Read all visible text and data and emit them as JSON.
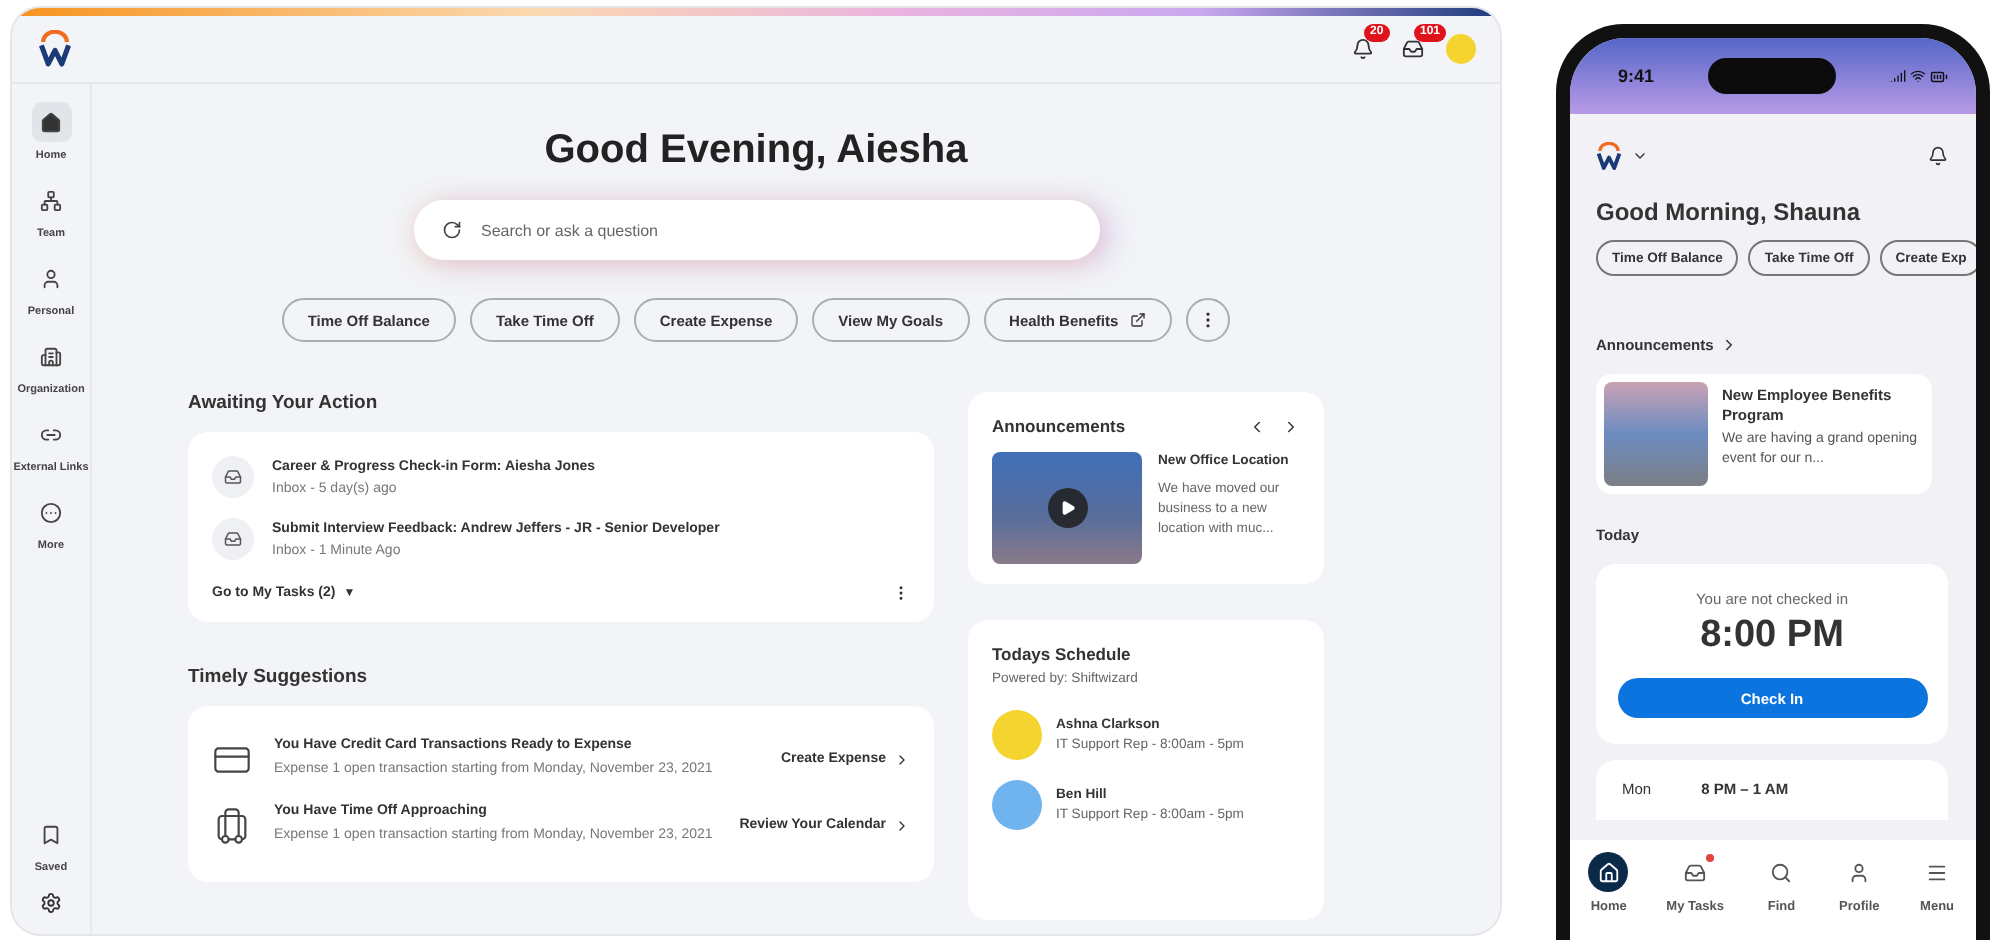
{
  "desktop": {
    "notifications": [
      {
        "kind": "bell",
        "count": "20"
      },
      {
        "kind": "inbox",
        "count": "101"
      }
    ],
    "sidebar": {
      "items": [
        {
          "label": "Home",
          "selected": true
        },
        {
          "label": "Team",
          "selected": false
        },
        {
          "label": "Personal",
          "selected": false
        },
        {
          "label": "Organization",
          "selected": false
        },
        {
          "label": "External Links",
          "selected": false
        },
        {
          "label": "More",
          "selected": false
        }
      ],
      "bottom_items": [
        {
          "label": "Saved",
          "selected": false
        }
      ]
    },
    "greeting": "Good Evening, Aiesha",
    "search": {
      "placeholder": "Search or ask a question"
    },
    "quick_actions": [
      {
        "label": "Time Off Balance",
        "external": false
      },
      {
        "label": "Take Time Off",
        "external": false
      },
      {
        "label": "Create Expense",
        "external": false
      },
      {
        "label": "View My Goals",
        "external": false
      },
      {
        "label": "Health Benefits",
        "external": true
      }
    ],
    "awaiting": {
      "title": "Awaiting Your Action",
      "tasks": [
        {
          "title": "Career & Progress Check-in Form: Aiesha Jones",
          "meta": "Inbox - 5 day(s) ago"
        },
        {
          "title": "Submit Interview Feedback: Andrew Jeffers - JR - Senior Developer",
          "meta": "Inbox - 1 Minute Ago"
        }
      ],
      "footer": "Go to My Tasks (2)",
      "footer_caret": "▼"
    },
    "suggestions": {
      "title": "Timely Suggestions",
      "items": [
        {
          "title": "You Have Credit Card Transactions Ready to Expense",
          "detail": "Expense 1 open transaction starting from Monday, November 23, 2021",
          "action": "Create Expense"
        },
        {
          "title": "You Have Time Off Approaching",
          "detail": "Expense 1 open transaction starting from Monday, November 23, 2021",
          "action": "Review Your Calendar"
        }
      ]
    },
    "announcements": {
      "title": "Announcements",
      "item": {
        "title": "New Office Location",
        "text": "We have moved our business to a new location with muc..."
      }
    },
    "schedule": {
      "title": "Todays Schedule",
      "powered_by": "Powered by: Shiftwizard",
      "people": [
        {
          "name": "Ashna Clarkson",
          "shift": "IT Support Rep - 8:00am - 5pm",
          "color": "#f5d430"
        },
        {
          "name": "Ben Hill",
          "shift": "IT Support Rep - 8:00am - 5pm",
          "color": "#6fb3ef"
        }
      ]
    }
  },
  "phone": {
    "time": "9:41",
    "greeting": "Good Morning, Shauna",
    "quick_actions": [
      "Time Off Balance",
      "Take Time Off",
      "Create Exp"
    ],
    "announcements_title": "Announcements",
    "announcement": {
      "title": "New Employee Benefits Program",
      "text": "We are having a grand opening event for our n..."
    },
    "today": {
      "title": "Today",
      "status": "You are not checked in",
      "time": "8:00 PM",
      "button": "Check In"
    },
    "shift": {
      "day": "Mon",
      "hours": "8 PM – 1 AM"
    },
    "nav": [
      {
        "label": "Home",
        "selected": true,
        "badge": false
      },
      {
        "label": "My Tasks",
        "selected": false,
        "badge": true
      },
      {
        "label": "Find",
        "selected": false,
        "badge": false
      },
      {
        "label": "Profile",
        "selected": false,
        "badge": false
      },
      {
        "label": "Menu",
        "selected": false,
        "badge": false
      }
    ]
  }
}
